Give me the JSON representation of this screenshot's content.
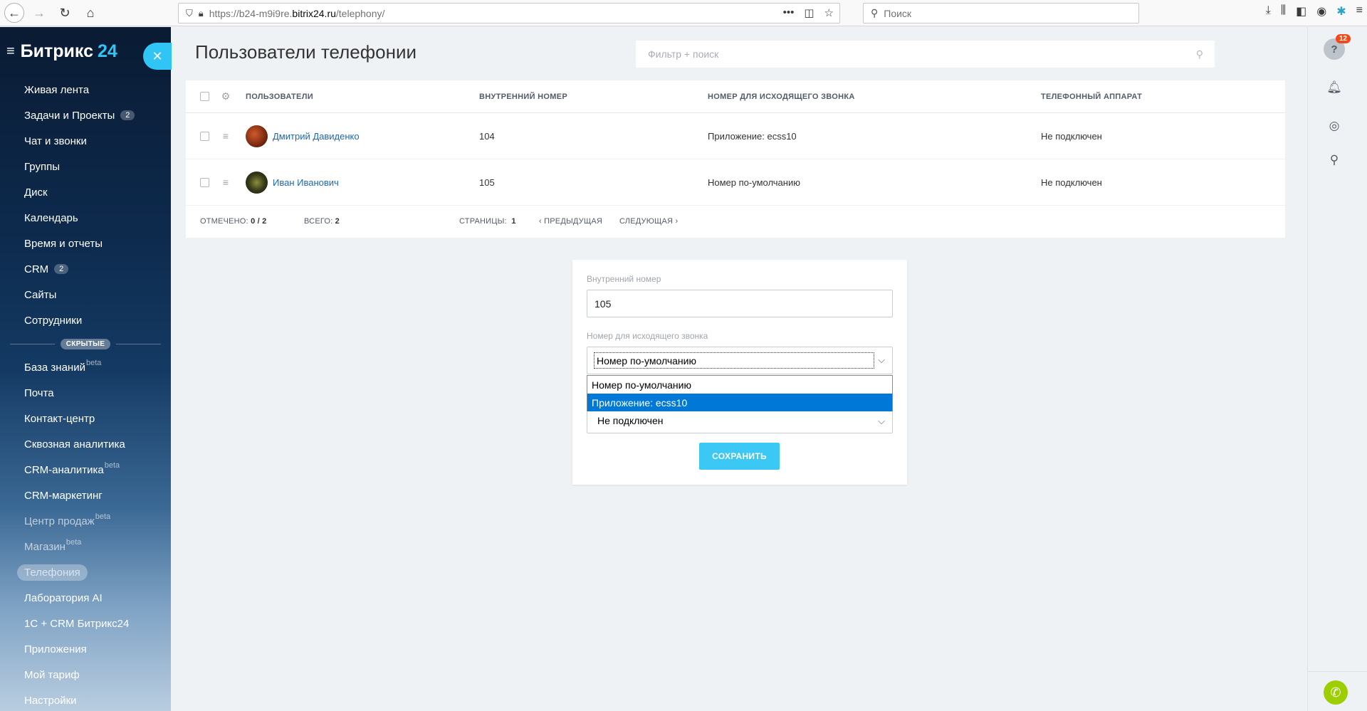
{
  "browser": {
    "url_prefix": "https://b24-m9i9re.",
    "url_domain": "bitrix24.ru",
    "url_path": "/telephony/",
    "search_placeholder": "Поиск",
    "more_label": "•••"
  },
  "sidebar": {
    "brand_name": "Битрикс",
    "brand_num": "24",
    "items": [
      {
        "label": "Живая лента",
        "count": "",
        "beta": ""
      },
      {
        "label": "Задачи и Проекты",
        "count": "2",
        "beta": ""
      },
      {
        "label": "Чат и звонки",
        "count": "",
        "beta": ""
      },
      {
        "label": "Группы",
        "count": "",
        "beta": ""
      },
      {
        "label": "Диск",
        "count": "",
        "beta": ""
      },
      {
        "label": "Календарь",
        "count": "",
        "beta": ""
      },
      {
        "label": "Время и отчеты",
        "count": "",
        "beta": ""
      },
      {
        "label": "CRM",
        "count": "2",
        "beta": ""
      },
      {
        "label": "Сайты",
        "count": "",
        "beta": ""
      },
      {
        "label": "Сотрудники",
        "count": "",
        "beta": ""
      }
    ],
    "hidden_label": "СКРЫТЫЕ",
    "hidden_items": [
      {
        "label": "База знаний",
        "beta": "beta"
      },
      {
        "label": "Почта",
        "beta": ""
      },
      {
        "label": "Контакт-центр",
        "beta": ""
      },
      {
        "label": "Сквозная аналитика",
        "beta": ""
      },
      {
        "label": "CRM-аналитика",
        "beta": "beta"
      },
      {
        "label": "CRM-маркетинг",
        "beta": ""
      },
      {
        "label": "Центр продаж",
        "beta": "beta"
      },
      {
        "label": "Магазин",
        "beta": "beta"
      },
      {
        "label": "Телефония",
        "beta": ""
      },
      {
        "label": "Лаборатория AI",
        "beta": ""
      },
      {
        "label": "1С + CRM Битрикс24",
        "beta": ""
      },
      {
        "label": "Приложения",
        "beta": ""
      },
      {
        "label": "Мой тариф",
        "beta": ""
      },
      {
        "label": "Настройки",
        "beta": ""
      }
    ]
  },
  "main": {
    "title": "Пользователи телефонии",
    "filter_placeholder": "Фильтр + поиск"
  },
  "grid": {
    "columns": {
      "users": "ПОЛЬЗОВАТЕЛИ",
      "internal": "ВНУТРЕННИЙ НОМЕР",
      "outgoing": "НОМЕР ДЛЯ ИСХОДЯЩЕГО ЗВОНКА",
      "device": "ТЕЛЕФОННЫЙ АППАРАТ"
    },
    "rows": [
      {
        "name": "Дмитрий Давиденко",
        "internal": "104",
        "outgoing": "Приложение: ecss10",
        "device": "Не подключен"
      },
      {
        "name": "Иван Иванович",
        "internal": "105",
        "outgoing": "Номер по-умолчанию",
        "device": "Не подключен"
      }
    ],
    "footer": {
      "marked_label": "ОТМЕЧЕНО:",
      "marked_value": "0 / 2",
      "total_label": "ВСЕГО:",
      "total_value": "2",
      "pages_label": "СТРАНИЦЫ:",
      "pages_value": "1",
      "prev": "ПРЕДЫДУЩАЯ",
      "next": "СЛЕДУЮЩАЯ"
    }
  },
  "edit": {
    "internal_label": "Внутренний номер",
    "internal_value": "105",
    "outgoing_label": "Номер для исходящего звонка",
    "outgoing_value": "Номер по-умолчанию",
    "options": [
      "Номер по-умолчанию",
      "Приложение: ecss10"
    ],
    "selected_option_index": 1,
    "device_value": "Не подключен",
    "save_label": "СОХРАНИТЬ"
  },
  "right_panel": {
    "help_badge": "12"
  }
}
